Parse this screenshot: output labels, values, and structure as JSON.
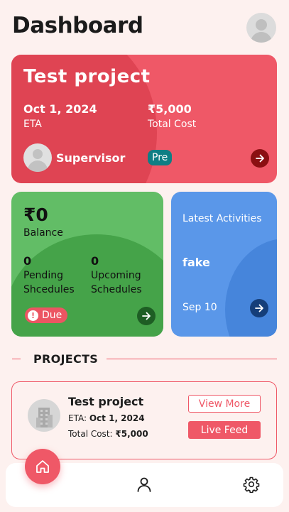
{
  "header": {
    "title": "Dashboard",
    "avatar_icon": "user-avatar-icon"
  },
  "project_card": {
    "title": "Test project",
    "eta_value": "Oct 1, 2024",
    "eta_label": "ETA",
    "cost_value": "₹5,000",
    "cost_label": "Total Cost",
    "supervisor_label": "Supervisor",
    "stage_badge": "Pre",
    "color": "#ef5867"
  },
  "balance_card": {
    "amount": "₹0",
    "label": "Balance",
    "pending_count": "0",
    "pending_label": "Pending Shcedules",
    "upcoming_count": "0",
    "upcoming_label": "Upcoming Schedules",
    "due_badge": "Due",
    "color": "#62bd66"
  },
  "activities_card": {
    "title": "Latest Activities",
    "latest_text": "fake",
    "date": "Sep 10",
    "color": "#5a97e9"
  },
  "projects_section": {
    "title": "PROJECTS"
  },
  "project_list": [
    {
      "title": "Test project",
      "eta_label": "ETA:",
      "eta_value": "Oct 1, 2024",
      "cost_label": "Total Cost:",
      "cost_value": "₹5,000",
      "view_more_label": "View More",
      "live_feed_label": "Live Feed"
    }
  ],
  "bottom_nav": {
    "items": [
      {
        "icon": "home-icon",
        "active": true
      },
      {
        "icon": "user-icon",
        "active": false
      },
      {
        "icon": "gear-icon",
        "active": false
      }
    ]
  }
}
